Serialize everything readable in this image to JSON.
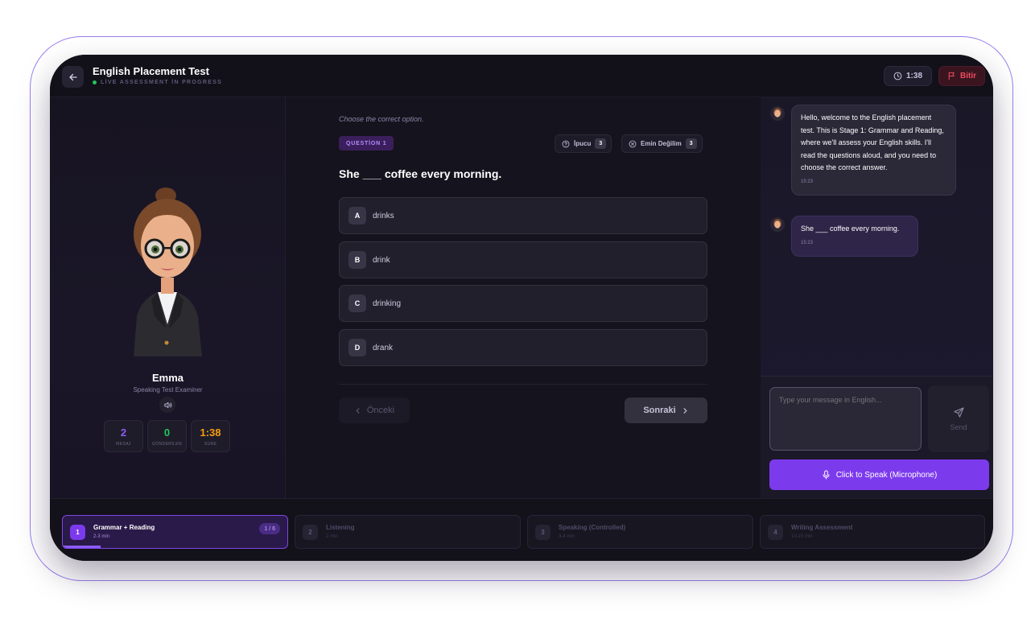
{
  "header": {
    "title": "English Placement Test",
    "subtitle": "LİVE ASSESSMENT İN PROGRESS",
    "timer": "1:38",
    "finish_label": "Bitir"
  },
  "examiner": {
    "name": "Emma",
    "role": "Speaking Test Examiner",
    "stats": [
      {
        "value": "2",
        "label": "MESAJ",
        "color": "#8b5cf6"
      },
      {
        "value": "0",
        "label": "GÖNDERİLEN",
        "color": "#22c55e"
      },
      {
        "value": "1:38",
        "label": "SÜRE",
        "color": "#f59e0b"
      }
    ]
  },
  "quiz": {
    "instruction": "Choose the correct option.",
    "question_badge": "QUESTİON 1",
    "hint_label": "İpucu",
    "hint_count": "3",
    "unsure_label": "Emin Değilim",
    "unsure_count": "3",
    "question": "She ___ coffee every morning.",
    "options": [
      {
        "key": "A",
        "text": "drinks"
      },
      {
        "key": "B",
        "text": "drink"
      },
      {
        "key": "C",
        "text": "drinking"
      },
      {
        "key": "D",
        "text": "drank"
      }
    ],
    "prev_label": "Önceki",
    "next_label": "Sonraki"
  },
  "chat": {
    "messages": [
      {
        "text": "Hello, welcome to the English placement test. This is Stage 1: Grammar and Reading, where we'll assess your English skills. I'll read the questions aloud, and you need to choose the correct answer.",
        "time": "15:23"
      },
      {
        "text": "She ___ coffee every morning.",
        "time": "15:23"
      }
    ],
    "input_placeholder": "Type your message in English...",
    "send_label": "Send",
    "speak_label": "Click to Speak (Microphone)"
  },
  "stages": [
    {
      "num": "1",
      "title": "Grammar + Reading",
      "duration": "2-3 min",
      "badge": "1 / 6",
      "active": true,
      "progress": 0.17
    },
    {
      "num": "2",
      "title": "Listening",
      "duration": "2 min",
      "active": false
    },
    {
      "num": "3",
      "title": "Speaking (Controlled)",
      "duration": "3-4 min",
      "active": false
    },
    {
      "num": "4",
      "title": "Writing Assessment",
      "duration": "10-15 min",
      "active": false
    }
  ],
  "colors": {
    "accent": "#7c3aed",
    "live": "#22c55e",
    "danger": "#ef4a5f"
  }
}
